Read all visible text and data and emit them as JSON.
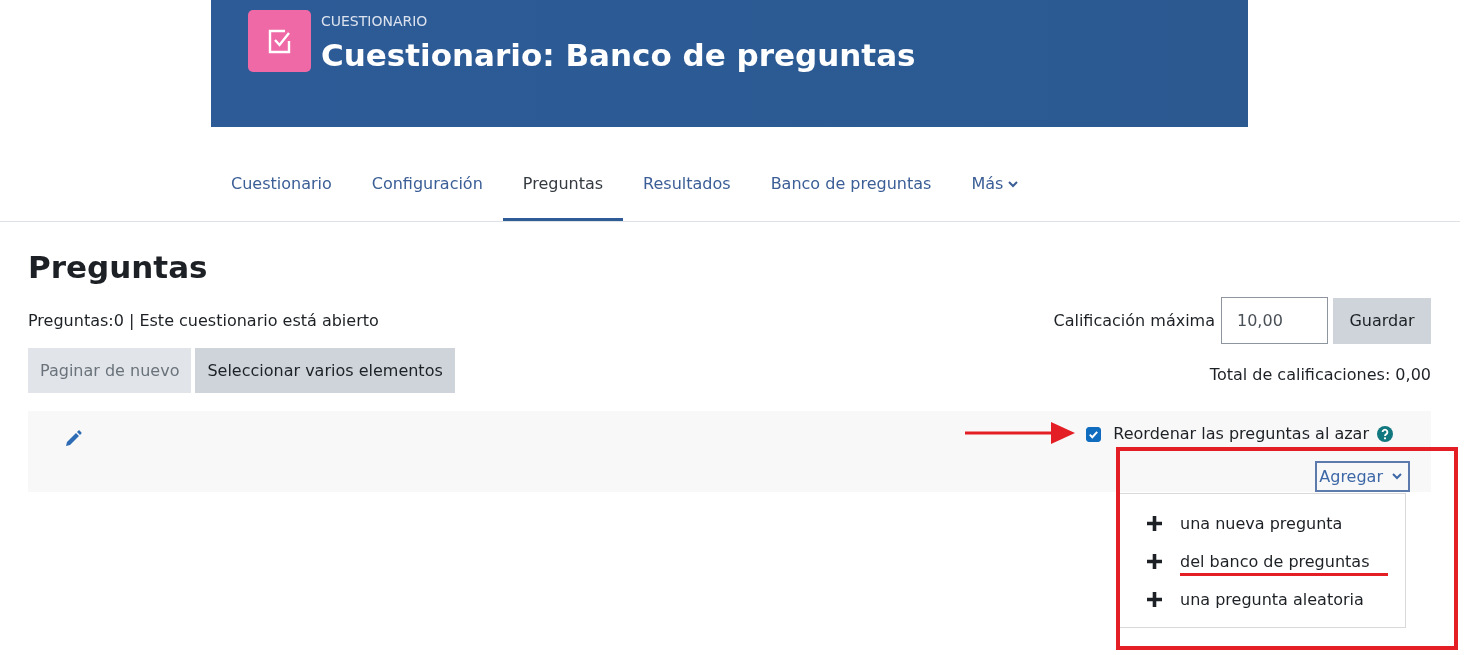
{
  "header": {
    "context": "CUESTIONARIO",
    "title": "Cuestionario: Banco de preguntas"
  },
  "tabs": [
    {
      "label": "Cuestionario",
      "kind": "link",
      "selected": false
    },
    {
      "label": "Configuración",
      "kind": "link",
      "selected": false
    },
    {
      "label": "Preguntas",
      "kind": "link",
      "selected": true
    },
    {
      "label": "Resultados",
      "kind": "link",
      "selected": false
    },
    {
      "label": "Banco de preguntas",
      "kind": "link",
      "selected": false
    },
    {
      "label": "Más",
      "kind": "dropdown",
      "selected": false
    }
  ],
  "page": {
    "heading": "Preguntas",
    "summary": "Preguntas:0 | Este cuestionario está abierto"
  },
  "actions": [
    {
      "label": "Paginar de nuevo",
      "disabled": true
    },
    {
      "label": "Seleccionar varios elementos",
      "disabled": false
    }
  ],
  "max_grade": {
    "label": "Calificación máxima",
    "value": "10,00",
    "button": "Guardar"
  },
  "total": "Total de calificaciones: 0,00",
  "section": {
    "shuffle": {
      "label": "Reordenar las preguntas al azar",
      "checked": true,
      "annotated": true
    },
    "add_menu": {
      "label": "Agregar",
      "expanded": true,
      "annotated": true,
      "items": [
        {
          "label": "una nueva pregunta",
          "annotated": false
        },
        {
          "label": "del banco de preguntas",
          "annotated": true
        },
        {
          "label": "una pregunta aleatoria",
          "annotated": false
        }
      ]
    }
  }
}
